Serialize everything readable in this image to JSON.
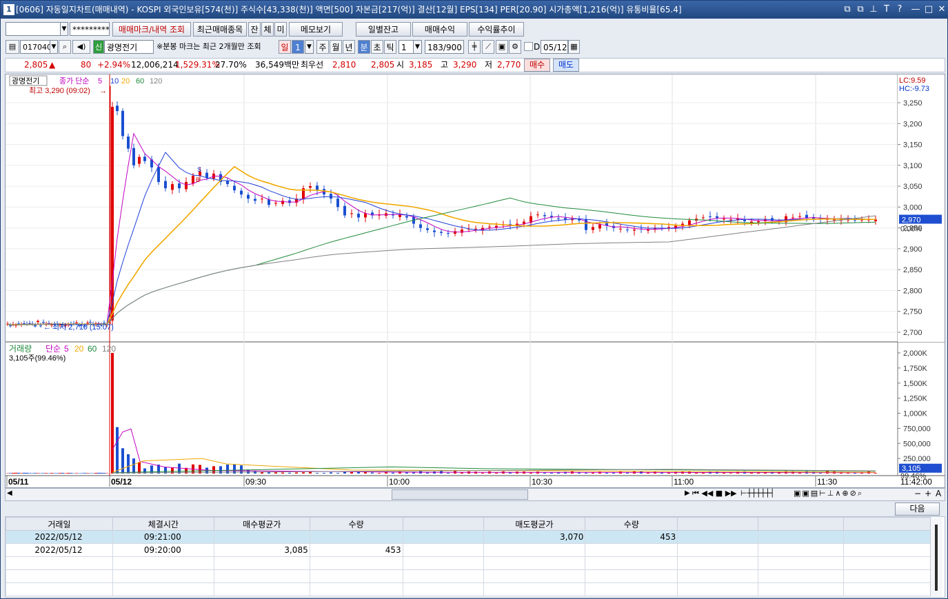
{
  "window": {
    "number": "1",
    "title": "[0606] 차트(매매내역) - KOSPI 외국인보유[574(천)] 주식수[43,338(천)] 액면[500] 자본금[217(억)] 결산[12월] EPS[134] PER[20.90] 시가총액[1,216(억)] 유통비율[65.4]",
    "title_full": "[0606] 자동일지차트(매매내역) - KOSPI 외국인보유[574(천)] 주식수[43,338(천)] 액면[500] 자본금[217(억)] 결산[12월] EPS[134] PER[20.90] 시가총액[1,216(억)] 유통비율[65.4]",
    "buttons": [
      "⧉",
      "⧉",
      "⊥",
      "T",
      "?",
      "—",
      "□",
      "✕"
    ]
  },
  "toolbar1": {
    "account_value": "",
    "password_mask": "*********",
    "btn_marks": "매매마크/내역 조회",
    "btn_recent": "최근매매종목",
    "btn_jan": "잔",
    "btn_che": "체",
    "btn_mi": "미",
    "btn_memo": "메모보기",
    "btn_daily": "일별잔고",
    "btn_profit": "매매수익",
    "btn_rate": "수익률추이"
  },
  "toolbar2": {
    "code": "017040",
    "badge": "신",
    "stock_name": "광명전기",
    "notice": "※분봉 마크는 최근 2개월만 조회",
    "period_day": "일",
    "period_num": "1",
    "period_week": "주",
    "period_month": "월",
    "period_year": "년",
    "period_min": "분",
    "period_sec": "초",
    "period_tick": "틱",
    "interval": "1",
    "count": "183/900",
    "d_label": "D",
    "date": "05/12"
  },
  "quote": {
    "price": "2,805",
    "arrow": "▲",
    "change": "80",
    "change_pct": "+2.94%",
    "volume": "12,006,214",
    "vol_pct": "1,529.31%",
    "turnover": "27.70%",
    "amount": "36,549백만",
    "best_label": "최우선",
    "best_ask": "2,810",
    "best_bid": "2,805",
    "open_label": "시",
    "open": "3,185",
    "high_label": "고",
    "high": "3,290",
    "low_label": "저",
    "low": "2,770",
    "buy_btn": "매수",
    "sell_btn": "매도"
  },
  "price_pane": {
    "stock_label": "광명전기",
    "ma_label": "종가 단순",
    "ma": [
      "5",
      "10",
      "20",
      "60",
      "120"
    ],
    "high_marker": "최고 3,290 (09:02)",
    "low_marker": "최저 2,710 (15:07)",
    "lc": "LC:9.59",
    "hc": "HC:-9.73",
    "current_tag": "2,970",
    "pct_tag": "0.00%",
    "y_ticks": [
      "3,250",
      "3,200",
      "3,150",
      "3,100",
      "3,050",
      "3,000",
      "2,950",
      "2,900",
      "2,850",
      "2,800",
      "2,750",
      "2,700"
    ]
  },
  "volume_pane": {
    "label": "거래량",
    "ma_label": "단순",
    "ma": [
      "5",
      "20",
      "60",
      "120"
    ],
    "current": "3,105주(99.46%)",
    "y_ticks": [
      "2,000K",
      "1,750K",
      "1,500K",
      "1,250K",
      "1,000K",
      "750,000",
      "500,000",
      "250,000"
    ],
    "current_tag": "3,105",
    "pct_tag": "99.46%"
  },
  "x_axis": {
    "labels": [
      "05/11",
      "05/12",
      "09:30",
      "10:00",
      "10:30",
      "11:00",
      "11:30"
    ],
    "end_time": "11:42:00"
  },
  "colors": {
    "up": "#e00000",
    "down": "#1a4fd0",
    "ma5": "#c000c0",
    "ma10": "#1f3fd8",
    "ma20": "#f0a800",
    "ma60": "#1f8a3a",
    "ma120": "#808080"
  },
  "table": {
    "next_btn": "다음",
    "headers": [
      "거래일",
      "체결시간",
      "매수평균가",
      "수량",
      "",
      "매도평균가",
      "수량",
      "",
      "",
      ""
    ],
    "rows": [
      [
        "2022/05/12",
        "09:21:00",
        "",
        "",
        "",
        "3,070",
        "453",
        "",
        "",
        ""
      ],
      [
        "2022/05/12",
        "09:20:00",
        "3,085",
        "453",
        "",
        "",
        "",
        "",
        "",
        ""
      ]
    ]
  }
}
